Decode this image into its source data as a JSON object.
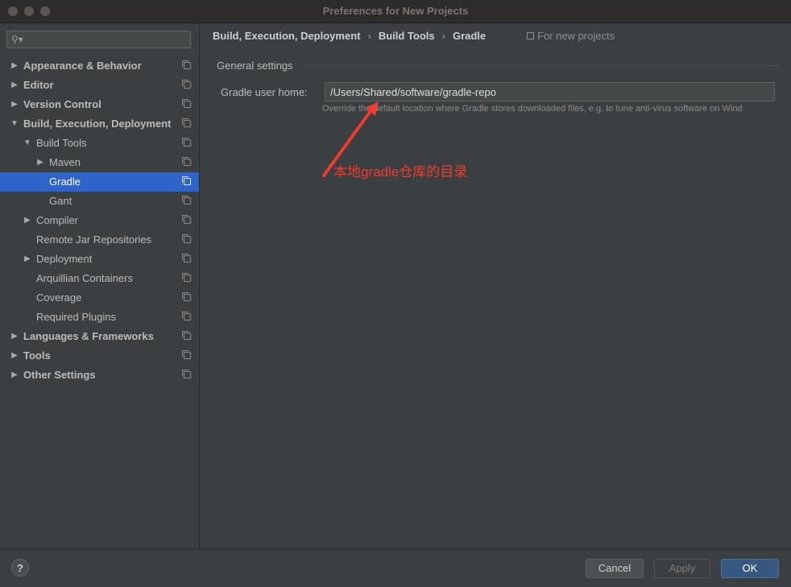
{
  "window": {
    "title": "Preferences for New Projects"
  },
  "search": {
    "placeholder": ""
  },
  "tree": [
    {
      "label": "Appearance & Behavior",
      "depth": 0,
      "arrow": "▶",
      "bold": true
    },
    {
      "label": "Editor",
      "depth": 0,
      "arrow": "▶",
      "bold": true
    },
    {
      "label": "Version Control",
      "depth": 0,
      "arrow": "▶",
      "bold": true
    },
    {
      "label": "Build, Execution, Deployment",
      "depth": 0,
      "arrow": "▼",
      "bold": true
    },
    {
      "label": "Build Tools",
      "depth": 1,
      "arrow": "▼",
      "bold": false
    },
    {
      "label": "Maven",
      "depth": 2,
      "arrow": "▶",
      "bold": false
    },
    {
      "label": "Gradle",
      "depth": 2,
      "arrow": "",
      "bold": false,
      "selected": true
    },
    {
      "label": "Gant",
      "depth": 2,
      "arrow": "",
      "bold": false
    },
    {
      "label": "Compiler",
      "depth": 1,
      "arrow": "▶",
      "bold": false
    },
    {
      "label": "Remote Jar Repositories",
      "depth": 1,
      "arrow": "",
      "bold": false
    },
    {
      "label": "Deployment",
      "depth": 1,
      "arrow": "▶",
      "bold": false
    },
    {
      "label": "Arquillian Containers",
      "depth": 1,
      "arrow": "",
      "bold": false
    },
    {
      "label": "Coverage",
      "depth": 1,
      "arrow": "",
      "bold": false
    },
    {
      "label": "Required Plugins",
      "depth": 1,
      "arrow": "",
      "bold": false
    },
    {
      "label": "Languages & Frameworks",
      "depth": 0,
      "arrow": "▶",
      "bold": true
    },
    {
      "label": "Tools",
      "depth": 0,
      "arrow": "▶",
      "bold": true
    },
    {
      "label": "Other Settings",
      "depth": 0,
      "arrow": "▶",
      "bold": true
    }
  ],
  "breadcrumb": {
    "items": [
      "Build, Execution, Deployment",
      "Build Tools",
      "Gradle"
    ],
    "separator": "›"
  },
  "scope": {
    "label": "For new projects"
  },
  "settings": {
    "section_title": "General settings",
    "gradle_home_label": "Gradle user home:",
    "gradle_home_value": "/Users/Shared/software/gradle-repo",
    "hint": "Override the default location where Gradle stores downloaded files, e.g. to tune anti-virus software on Wind"
  },
  "annotation": {
    "text": "本地gradle仓库的目录",
    "color": "#f03c2d"
  },
  "footer": {
    "help": "?",
    "cancel": "Cancel",
    "apply": "Apply",
    "ok": "OK"
  },
  "colors": {
    "selection": "#2f65ca",
    "ok_button": "#365880"
  }
}
